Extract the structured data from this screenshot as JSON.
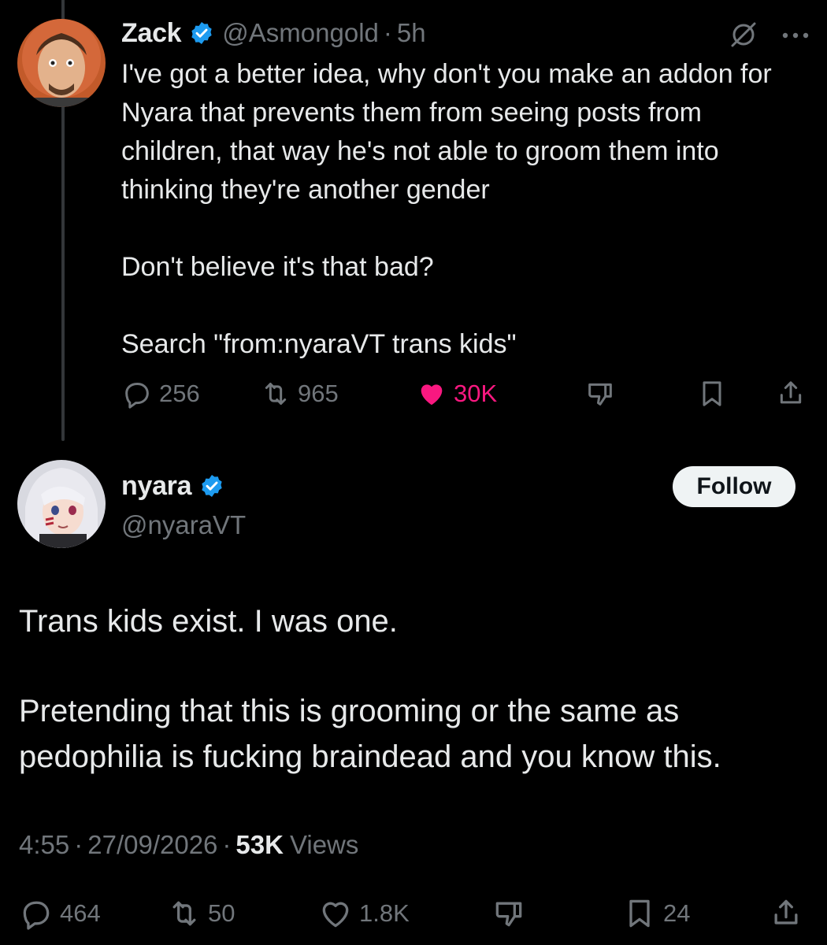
{
  "parent_tweet": {
    "author_name": "Zack",
    "author_handle": "@Asmongold",
    "separator": "·",
    "time": "5h",
    "body": "I've got a better idea, why don't you make an addon for Nyara that prevents them from seeing posts from children, that way he's not able to groom them into thinking they're another gender\n\nDon't believe it's that bad?\n\nSearch \"from:nyaraVT trans kids\"",
    "actions": {
      "replies": "256",
      "reposts": "965",
      "likes": "30K"
    }
  },
  "main_tweet": {
    "author_name": "nyara",
    "author_handle": "@nyaraVT",
    "follow_label": "Follow",
    "paragraphs": [
      "Trans kids exist. I was one.",
      "Pretending that this is grooming or the same as pedophilia is fucking braindead and you know this."
    ],
    "time": "4:55",
    "date": "27/09/2026",
    "separator": "·",
    "views_count": "53K",
    "views_label": "Views",
    "actions": {
      "replies": "464",
      "reposts": "50",
      "likes": "1.8K",
      "bookmarks": "24"
    }
  },
  "colors": {
    "background": "#000000",
    "text": "#e7e9ea",
    "muted": "#71767b",
    "like": "#f91880",
    "verified": "#1d9bf0"
  }
}
